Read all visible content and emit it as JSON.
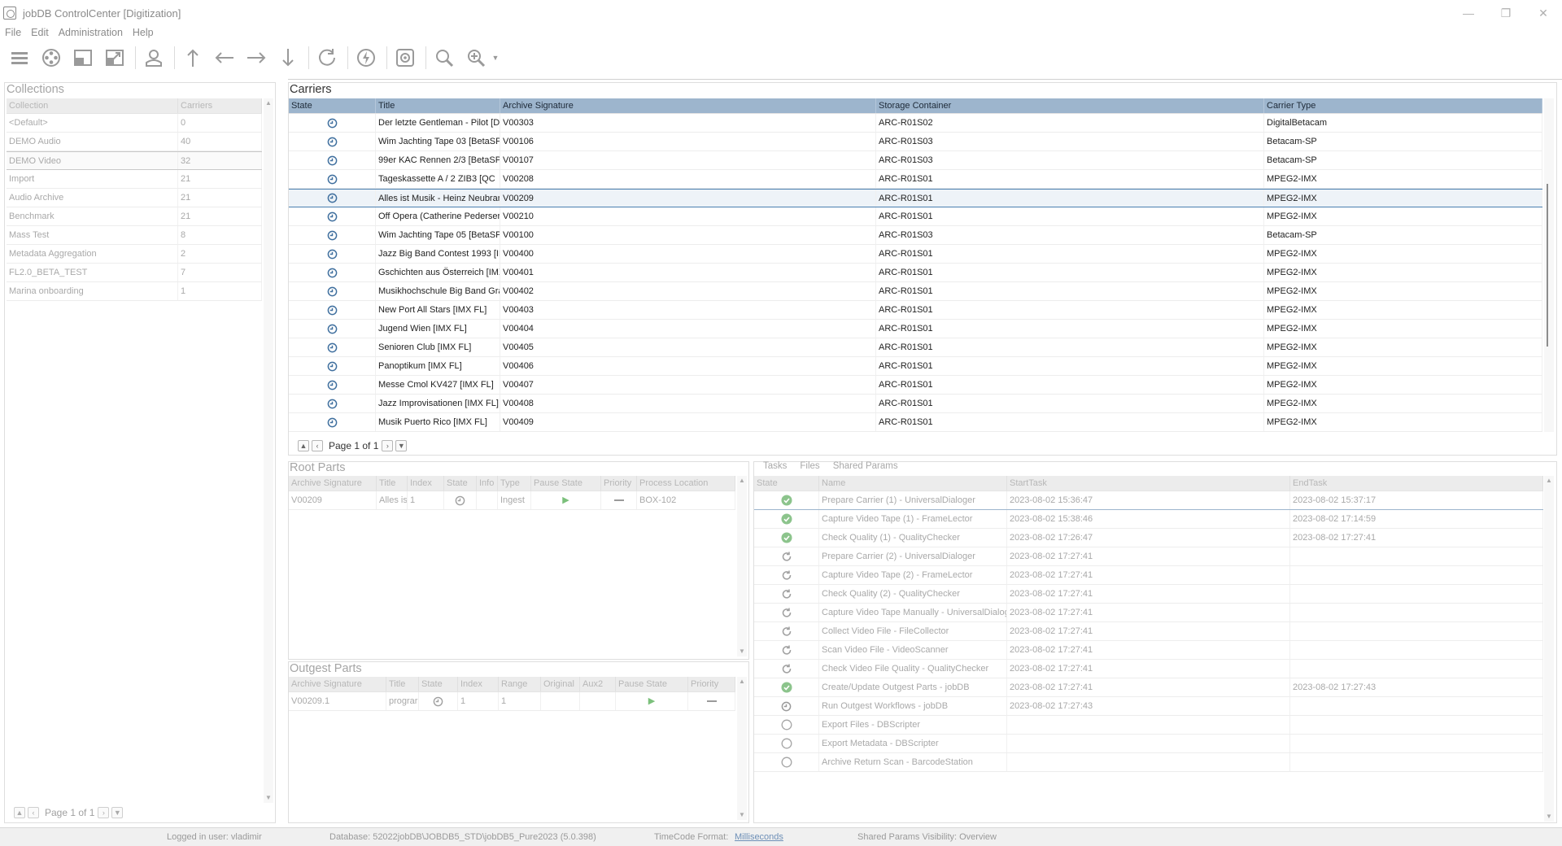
{
  "window": {
    "title": "jobDB ControlCenter [Digitization]",
    "controls": [
      "—",
      "❐",
      "✕"
    ]
  },
  "menu": [
    "File",
    "Edit",
    "Administration",
    "Help"
  ],
  "toolbar": {
    "icons": [
      "menu-icon",
      "film-reel-icon",
      "import-icon",
      "export-icon",
      "user-icon",
      "arrow-up-icon",
      "arrow-left-icon",
      "arrow-right-icon",
      "arrow-down-icon",
      "refresh-icon",
      "lightning-icon",
      "settings-icon",
      "zoom-icon",
      "zoom-options-icon"
    ]
  },
  "collections": {
    "title": "Collections",
    "columns": [
      "Collection",
      "Carriers"
    ],
    "rows": [
      {
        "name": "<Default>",
        "count": "0"
      },
      {
        "name": "DEMO Audio",
        "count": "40"
      },
      {
        "name": "DEMO Video",
        "count": "32"
      },
      {
        "name": "Import",
        "count": "21"
      },
      {
        "name": "Audio Archive",
        "count": "21"
      },
      {
        "name": "Benchmark",
        "count": "21"
      },
      {
        "name": "Mass Test",
        "count": "8"
      },
      {
        "name": "Metadata Aggregation",
        "count": "2"
      },
      {
        "name": "FL2.0_BETA_TEST",
        "count": "7"
      },
      {
        "name": "Marina onboarding",
        "count": "1"
      }
    ],
    "pager": "Page 1 of 1"
  },
  "carriers": {
    "title": "Carriers",
    "columns": [
      "State",
      "Title",
      "Archive Signature",
      "Storage Container",
      "Carrier Type"
    ],
    "rows": [
      {
        "title": "Der letzte Gentleman - Pilot [Di",
        "sig": "V00303",
        "container": "ARC-R01S02",
        "type": "DigitalBetacam"
      },
      {
        "title": "Wim Jachting Tape 03 [BetaSP",
        "sig": "V00106",
        "container": "ARC-R01S03",
        "type": "Betacam-SP"
      },
      {
        "title": "99er KAC Rennen 2/3 [BetaSP",
        "sig": "V00107",
        "container": "ARC-R01S03",
        "type": "Betacam-SP"
      },
      {
        "title": " Tageskassette A / 2  ZIB3 [QC",
        "sig": "V00208",
        "container": "ARC-R01S01",
        "type": "MPEG2-IMX"
      },
      {
        "title": "Alles ist Musik - Heinz Neubranc",
        "sig": "V00209",
        "container": "ARC-R01S01",
        "type": "MPEG2-IMX"
      },
      {
        "title": "Off Opera (Catherine Pederser",
        "sig": "V00210",
        "container": "ARC-R01S01",
        "type": "MPEG2-IMX"
      },
      {
        "title": "Wim Jachting Tape 05 [BetaSP",
        "sig": "V00100",
        "container": "ARC-R01S03",
        "type": "Betacam-SP"
      },
      {
        "title": "Jazz Big Band Contest 1993 [IM",
        "sig": "V00400",
        "container": "ARC-R01S01",
        "type": "MPEG2-IMX"
      },
      {
        "title": "Gschichten aus Österreich [IMX",
        "sig": "V00401",
        "container": "ARC-R01S01",
        "type": "MPEG2-IMX"
      },
      {
        "title": "Musikhochschule Big Band Graz",
        "sig": "V00402",
        "container": "ARC-R01S01",
        "type": "MPEG2-IMX"
      },
      {
        "title": "New Port All Stars [IMX FL]",
        "sig": "V00403",
        "container": "ARC-R01S01",
        "type": "MPEG2-IMX"
      },
      {
        "title": "Jugend Wien [IMX FL]",
        "sig": "V00404",
        "container": "ARC-R01S01",
        "type": "MPEG2-IMX"
      },
      {
        "title": "Senioren Club [IMX FL]",
        "sig": "V00405",
        "container": "ARC-R01S01",
        "type": "MPEG2-IMX"
      },
      {
        "title": "Panoptikum [IMX FL]",
        "sig": "V00406",
        "container": "ARC-R01S01",
        "type": "MPEG2-IMX"
      },
      {
        "title": "Messe Cmol KV427 [IMX FL]",
        "sig": "V00407",
        "container": "ARC-R01S01",
        "type": "MPEG2-IMX"
      },
      {
        "title": "Jazz Improvisationen [IMX FL]",
        "sig": "V00408",
        "container": "ARC-R01S01",
        "type": "MPEG2-IMX"
      },
      {
        "title": "Musik Puerto Rico [IMX FL]",
        "sig": "V00409",
        "container": "ARC-R01S01",
        "type": "MPEG2-IMX"
      }
    ],
    "pager": "Page 1 of 1"
  },
  "root_parts": {
    "title": "Root Parts",
    "columns": [
      "Archive Signature",
      "Title",
      "Index",
      "State",
      "Info",
      "Type",
      "Pause State",
      "Priority",
      "Process Location"
    ],
    "rows": [
      {
        "sig": "V00209",
        "title": "Alles is",
        "index": "1",
        "type": "Ingest",
        "location": "BOX-102"
      }
    ]
  },
  "outgest_parts": {
    "title": "Outgest Parts",
    "columns": [
      "Archive Signature",
      "Title",
      "State",
      "Index",
      "Range",
      "Original",
      "Aux2",
      "Pause State",
      "Priority"
    ],
    "rows": [
      {
        "sig": "V00209.1",
        "title": "prograr",
        "index": "1",
        "range": "1"
      }
    ]
  },
  "tasks": {
    "tabs": [
      "Tasks",
      "Files",
      "Shared Params"
    ],
    "columns": [
      "State",
      "Name",
      "StartTask",
      "EndTask"
    ],
    "rows": [
      {
        "state": "done",
        "name": "Prepare Carrier (1) - UniversalDialoger",
        "start": "2023-08-02 15:36:47",
        "end": "2023-08-02 15:37:17"
      },
      {
        "state": "done",
        "name": "Capture Video Tape (1) - FrameLector",
        "start": "2023-08-02 15:38:46",
        "end": "2023-08-02 17:14:59"
      },
      {
        "state": "done",
        "name": "Check Quality (1) - QualityChecker",
        "start": "2023-08-02 17:26:47",
        "end": "2023-08-02 17:27:41"
      },
      {
        "state": "skipped",
        "name": "Prepare Carrier (2) - UniversalDialoger",
        "start": "2023-08-02 17:27:41",
        "end": ""
      },
      {
        "state": "skipped",
        "name": "Capture Video Tape (2) - FrameLector",
        "start": "2023-08-02 17:27:41",
        "end": ""
      },
      {
        "state": "skipped",
        "name": "Check Quality (2) - QualityChecker",
        "start": "2023-08-02 17:27:41",
        "end": ""
      },
      {
        "state": "skipped",
        "name": "Capture Video Tape Manually - UniversalDialoge",
        "start": "2023-08-02 17:27:41",
        "end": ""
      },
      {
        "state": "skipped",
        "name": "Collect Video File - FileCollector",
        "start": "2023-08-02 17:27:41",
        "end": ""
      },
      {
        "state": "skipped",
        "name": "Scan Video File - VideoScanner",
        "start": "2023-08-02 17:27:41",
        "end": ""
      },
      {
        "state": "skipped",
        "name": "Check Video File Quality - QualityChecker",
        "start": "2023-08-02 17:27:41",
        "end": ""
      },
      {
        "state": "done",
        "name": "Create/Update Outgest Parts - jobDB",
        "start": "2023-08-02 17:27:41",
        "end": "2023-08-02 17:27:43"
      },
      {
        "state": "running",
        "name": "Run Outgest Workflows - jobDB",
        "start": "2023-08-02 17:27:43",
        "end": ""
      },
      {
        "state": "pending",
        "name": "Export Files - DBScripter",
        "start": "",
        "end": ""
      },
      {
        "state": "pending",
        "name": "Export Metadata - DBScripter",
        "start": "",
        "end": ""
      },
      {
        "state": "pending",
        "name": "Archive Return Scan - BarcodeStation",
        "start": "",
        "end": ""
      }
    ]
  },
  "status": {
    "user": "Logged in user: vladimir",
    "database": "Database: 52022jobDB\\JOBDB5_STD\\jobDB5_Pure2023 (5.0.398)",
    "timecode_label": "TimeCode Format:",
    "timecode_value": "Milliseconds",
    "shared": "Shared Params Visibility: Overview"
  },
  "colors": {
    "accent_header": "#9db5cd",
    "selection_border": "#4a7fb0",
    "done_green": "#7bbf7b",
    "cycle_blue": "#3f6f9e"
  }
}
